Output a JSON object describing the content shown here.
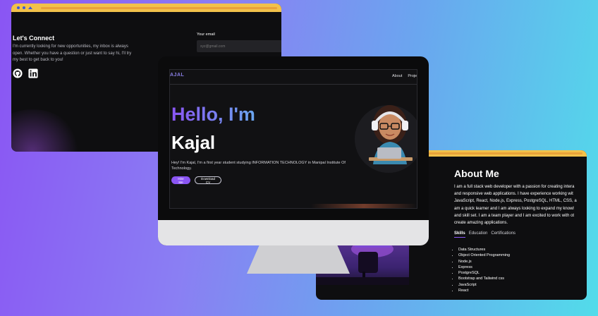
{
  "contact": {
    "title": "Let's Connect",
    "body": "I'm currently looking for new opportunities, my inbox is always open. Whether you have a question or just want to say hi, I'll try my best to get back to you!",
    "email_label": "Your email",
    "email_placeholder": "xyz@gmail.com",
    "social_icons": [
      "github-icon",
      "linkedin-icon"
    ]
  },
  "hero": {
    "logo": "AJAL",
    "nav": [
      "About",
      "Proje"
    ],
    "greeting": "Hello, I'm",
    "name": "Kajal",
    "description": "Hey! I'm Kajal, I'm a first year student studying INFORMATION TECHNOLOGY in Manipal Institute Of Technology.",
    "hire_button": "Hire Me",
    "cv_button": "Download CV"
  },
  "about": {
    "title": "About Me",
    "lines": [
      "I am a full stack web developer with a passion for creating intera",
      "and responsive web applications. I have experience working wit",
      "JavaScript, React, Node.js, Express, PostgreSQL, HTML, CSS, a",
      "am a quick learner and I am always looking to expand my knowl",
      "and skill set. I am a team player and I am excited to work with ot",
      "create amazing applications."
    ],
    "tabs": [
      "Skills",
      "Education",
      "Certifications"
    ],
    "active_tab": "Skills",
    "skills": [
      "Data Structures",
      "Object Oriented Programming",
      "Node.js",
      "Express",
      "PostgreSQL",
      "Bootstrap and Tailwind css",
      "JavaScript",
      "React"
    ]
  },
  "colors": {
    "accent": "#8a55f3",
    "topbar": "#f2c14a",
    "window_bg": "#0e0e10"
  }
}
